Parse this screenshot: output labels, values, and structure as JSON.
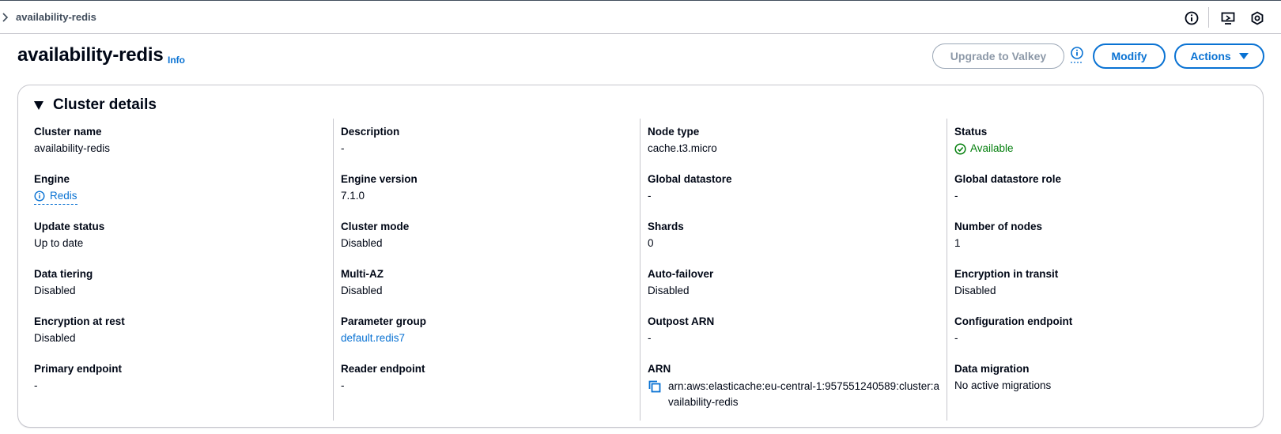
{
  "breadcrumb": {
    "current": "availability-redis"
  },
  "header": {
    "title": "availability-redis",
    "info_label": "Info",
    "upgrade_label": "Upgrade to Valkey",
    "modify_label": "Modify",
    "actions_label": "Actions"
  },
  "panel": {
    "title": "Cluster details",
    "columns": [
      [
        {
          "label": "Cluster name",
          "value": "availability-redis"
        },
        {
          "label": "Engine",
          "value": "Redis"
        },
        {
          "label": "Update status",
          "value": "Up to date"
        },
        {
          "label": "Data tiering",
          "value": "Disabled"
        },
        {
          "label": "Encryption at rest",
          "value": "Disabled"
        },
        {
          "label": "Primary endpoint",
          "value": "-"
        }
      ],
      [
        {
          "label": "Description",
          "value": "-"
        },
        {
          "label": "Engine version",
          "value": "7.1.0"
        },
        {
          "label": "Cluster mode",
          "value": "Disabled"
        },
        {
          "label": "Multi-AZ",
          "value": "Disabled"
        },
        {
          "label": "Parameter group",
          "value": "default.redis7"
        },
        {
          "label": "Reader endpoint",
          "value": "-"
        }
      ],
      [
        {
          "label": "Node type",
          "value": "cache.t3.micro"
        },
        {
          "label": "Global datastore",
          "value": "-"
        },
        {
          "label": "Shards",
          "value": "0"
        },
        {
          "label": "Auto-failover",
          "value": "Disabled"
        },
        {
          "label": "Outpost ARN",
          "value": "-"
        },
        {
          "label": "ARN",
          "value": "arn:aws:elasticache:eu-central-1:957551240589:cluster:availability-redis"
        }
      ],
      [
        {
          "label": "Status",
          "value": "Available"
        },
        {
          "label": "Global datastore role",
          "value": "-"
        },
        {
          "label": "Number of nodes",
          "value": "1"
        },
        {
          "label": "Encryption in transit",
          "value": "Disabled"
        },
        {
          "label": "Configuration endpoint",
          "value": "-"
        },
        {
          "label": "Data migration",
          "value": "No active migrations"
        }
      ]
    ]
  },
  "colors": {
    "link": "#0972d3",
    "success": "#037f0c",
    "text": "#000716",
    "border": "#c6c6cd"
  },
  "icons": [
    "chevron-right-icon",
    "info-icon",
    "screen-icon",
    "settings-icon",
    "caret-down-icon",
    "collapse-triangle-icon",
    "status-success-icon",
    "copy-icon"
  ]
}
